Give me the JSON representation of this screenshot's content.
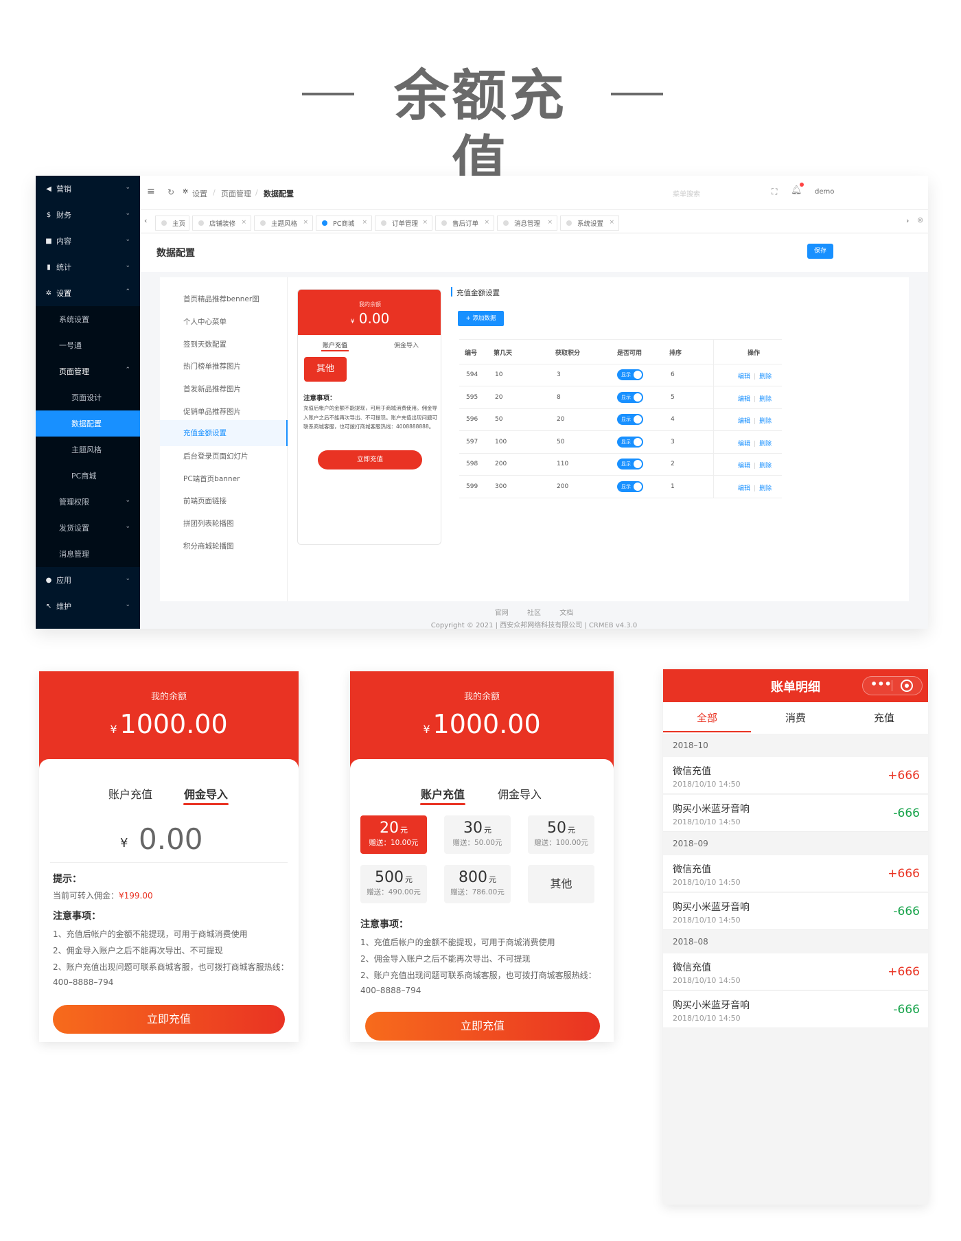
{
  "hero": {
    "title": "余额充值"
  },
  "admin": {
    "sidebar": [
      {
        "icon": "◀",
        "label": "营销"
      },
      {
        "icon": "$",
        "label": "财务"
      },
      {
        "icon": "■",
        "label": "内容"
      },
      {
        "icon": "▮",
        "label": "统计"
      },
      {
        "icon": "✲",
        "label": "设置"
      },
      {
        "label": "系统设置"
      },
      {
        "label": "一号通"
      },
      {
        "label": "页面管理"
      },
      {
        "label": "页面设计"
      },
      {
        "label": "数据配置"
      },
      {
        "label": "主题风格"
      },
      {
        "label": "PC商城"
      },
      {
        "label": "管理权限"
      },
      {
        "label": "发货设置"
      },
      {
        "label": "消息管理"
      },
      {
        "icon": "●",
        "label": "应用"
      },
      {
        "icon": "↖",
        "label": "维护"
      }
    ],
    "breadcrumb": {
      "home": "设置",
      "mid": "页面管理",
      "current": "数据配置"
    },
    "search_placeholder": "菜单搜索",
    "user": "demo",
    "tabs": [
      "主页",
      "店铺装修",
      "主题风格",
      "PC商城",
      "订单管理",
      "售后订单",
      "消息管理",
      "系统设置"
    ],
    "page_title": "数据配置",
    "save_label": "保存",
    "config_nav": [
      "首页精品推荐benner图",
      "个人中心菜单",
      "签到天数配置",
      "热门榜单推荐图片",
      "首发新品推荐图片",
      "促销单品推荐图片",
      "充值金额设置",
      "后台登录页面幻灯片",
      "PC端首页banner",
      "前端页面链接",
      "拼团列表轮播图",
      "积分商城轮播图"
    ],
    "preview": {
      "balance_label": "我的余额",
      "currency": "¥",
      "balance": "0.00",
      "tab_recharge": "账户充值",
      "tab_import": "佣金导入",
      "other": "其他",
      "notes_title": "注意事项：",
      "notes": "充值后帐户的金额不能提现，可用于商城消费使用。佣金导入账户之后不能再次导出、不可提现。账户充值出现问题可联系商城客服，也可拨打商城客服热线：4008888888。",
      "button": "立即充值"
    },
    "section_title": "充值金额设置",
    "add_button": "+ 添加数据",
    "table": {
      "headers": [
        "编号",
        "第几天",
        "获取积分",
        "是否可用",
        "排序",
        "操作"
      ],
      "toggle_label": "显示",
      "edit": "编辑",
      "delete": "删除",
      "rows": [
        [
          "594",
          "10",
          "3",
          "6"
        ],
        [
          "595",
          "20",
          "8",
          "5"
        ],
        [
          "596",
          "50",
          "20",
          "4"
        ],
        [
          "597",
          "100",
          "50",
          "3"
        ],
        [
          "598",
          "200",
          "110",
          "2"
        ],
        [
          "599",
          "300",
          "200",
          "1"
        ]
      ]
    },
    "footer_links": [
      "官网",
      "社区",
      "文档"
    ],
    "copyright": "Copyright © 2021 | 西安众邦网络科技有限公司 | CRMEB v4.3.0"
  },
  "card1": {
    "balance_label": "我的余额",
    "currency": "¥",
    "balance": "1000.00",
    "tab_recharge": "账户充值",
    "tab_import": "佣金导入",
    "input_currency": "¥",
    "input_value": "0.00",
    "tip_title": "提示：",
    "tip_text": "当前可转入佣金：",
    "tip_amount": "¥199.00",
    "notes_title": "注意事项：",
    "notes": [
      "1、充值后帐户的金额不能提现，可用于商城消费使用",
      "2、佣金导入账户之后不能再次导出、不可提现",
      "2、账户充值出现问题可联系商城客服，也可拨打商城客服热线：",
      "400–8888–794"
    ],
    "button": "立即充值"
  },
  "card2": {
    "balance_label": "我的余额",
    "currency": "¥",
    "balance": "1000.00",
    "tab_recharge": "账户充值",
    "tab_import": "佣金导入",
    "unit": "元",
    "amounts": [
      {
        "value": "20",
        "gift": "赠送：10.00元"
      },
      {
        "value": "30",
        "gift": "赠送：50.00元"
      },
      {
        "value": "50",
        "gift": "赠送：100.00元"
      },
      {
        "value": "500",
        "gift": "赠送：490.00元"
      },
      {
        "value": "800",
        "gift": "赠送：786.00元"
      }
    ],
    "other": "其他",
    "notes_title": "注意事项：",
    "notes": [
      "1、充值后帐户的金额不能提现，可用于商城消费使用",
      "2、佣金导入账户之后不能再次导出、不可提现",
      "2、账户充值出现问题可联系商城客服，也可拨打商城客服热线：",
      "400–8888–794"
    ],
    "button": "立即充值"
  },
  "card3": {
    "title": "账单明细",
    "tabs": [
      "全部",
      "消费",
      "充值"
    ],
    "groups": [
      {
        "month": "2018–10",
        "items": [
          {
            "title": "微信充值",
            "date": "2018/10/10 14:50",
            "amount": "+666"
          },
          {
            "title": "购买小米蓝牙音响",
            "date": "2018/10/10 14:50",
            "amount": "-666"
          }
        ]
      },
      {
        "month": "2018–09",
        "items": [
          {
            "title": "微信充值",
            "date": "2018/10/10 14:50",
            "amount": "+666"
          },
          {
            "title": "购买小米蓝牙音响",
            "date": "2018/10/10 14:50",
            "amount": "-666"
          }
        ]
      },
      {
        "month": "2018–08",
        "items": [
          {
            "title": "微信充值",
            "date": "2018/10/10 14:50",
            "amount": "+666"
          },
          {
            "title": "购买小米蓝牙音响",
            "date": "2018/10/10 14:50",
            "amount": "-666"
          }
        ]
      }
    ],
    "colors": {
      "plus": "#e93323",
      "minus": "#16a34a"
    }
  }
}
